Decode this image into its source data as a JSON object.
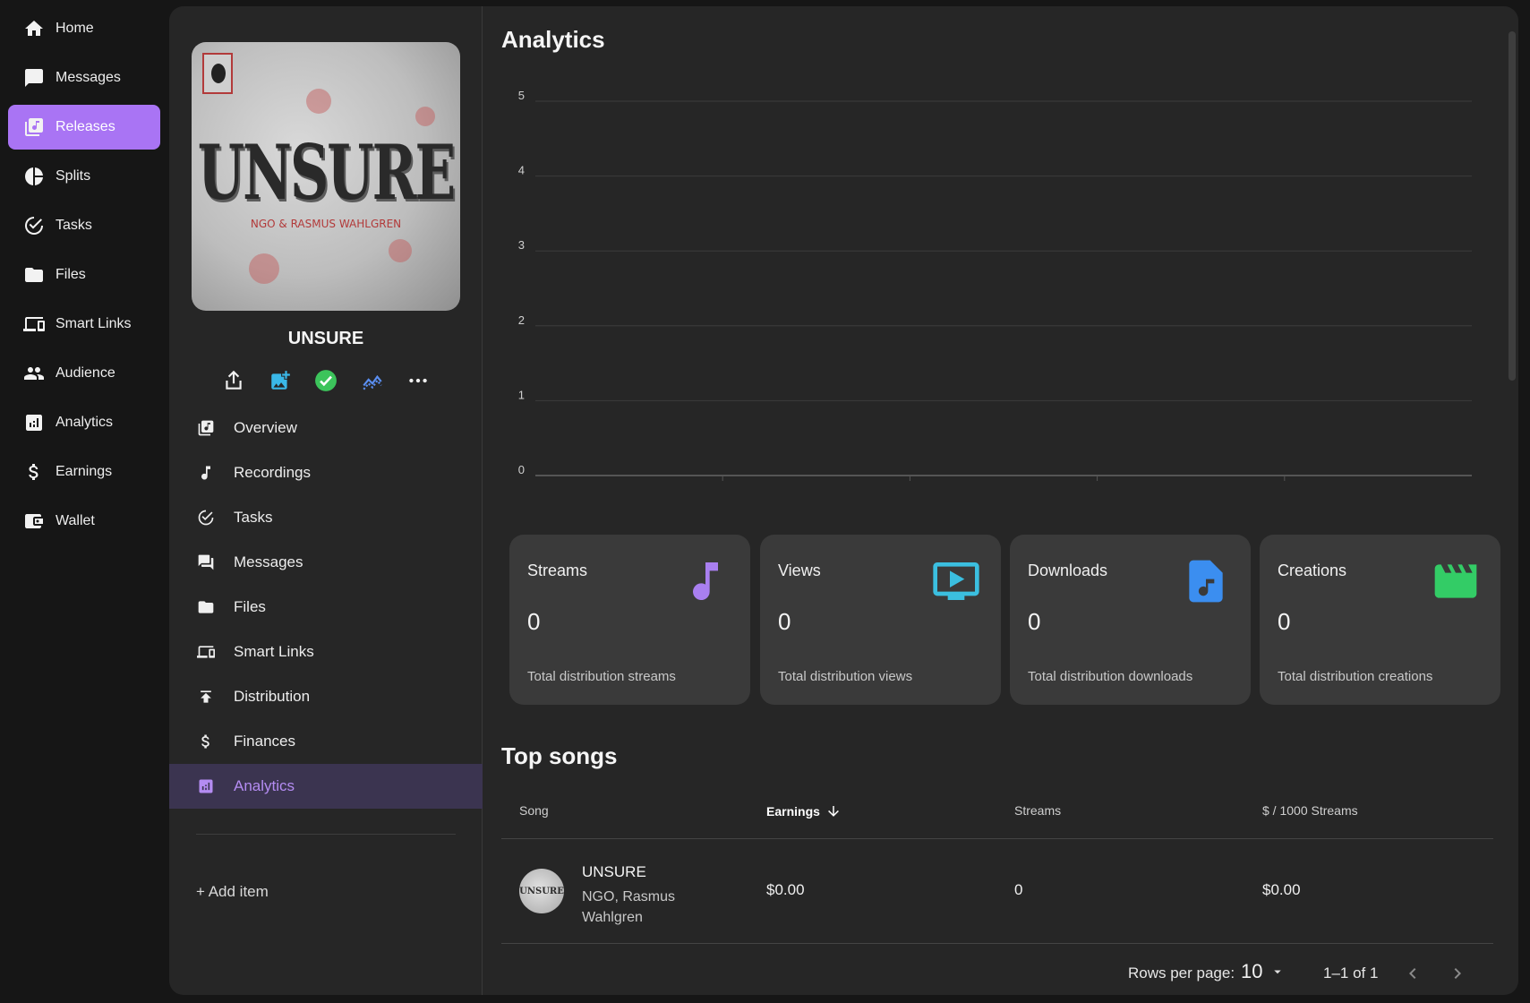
{
  "sidebar": {
    "items": [
      {
        "label": "Home",
        "icon": "home-icon"
      },
      {
        "label": "Messages",
        "icon": "chat-icon"
      },
      {
        "label": "Releases",
        "icon": "releases-icon",
        "active": true
      },
      {
        "label": "Splits",
        "icon": "pie-chart-icon"
      },
      {
        "label": "Tasks",
        "icon": "check-circle-icon"
      },
      {
        "label": "Files",
        "icon": "folder-icon"
      },
      {
        "label": "Smart Links",
        "icon": "devices-icon"
      },
      {
        "label": "Audience",
        "icon": "people-icon"
      },
      {
        "label": "Analytics",
        "icon": "bar-chart-icon"
      },
      {
        "label": "Earnings",
        "icon": "dollar-icon"
      },
      {
        "label": "Wallet",
        "icon": "wallet-icon"
      }
    ],
    "accent": "#a974f4"
  },
  "release": {
    "name": "UNSURE",
    "cover_title": "UNSURE",
    "cover_artists": "NGO & RASMUS WAHLGREN",
    "actions": [
      "share-icon",
      "add-image-icon",
      "check-icon",
      "insights-icon",
      "more-icon"
    ],
    "menu": [
      {
        "label": "Overview",
        "icon": "releases-icon"
      },
      {
        "label": "Recordings",
        "icon": "music-note-icon"
      },
      {
        "label": "Tasks",
        "icon": "check-circle-icon"
      },
      {
        "label": "Messages",
        "icon": "forum-icon"
      },
      {
        "label": "Files",
        "icon": "folder-icon"
      },
      {
        "label": "Smart Links",
        "icon": "devices-icon"
      },
      {
        "label": "Distribution",
        "icon": "publish-icon"
      },
      {
        "label": "Finances",
        "icon": "dollar-icon"
      },
      {
        "label": "Analytics",
        "icon": "bar-chart-icon",
        "active": true
      }
    ],
    "add_item": "+ Add item"
  },
  "analytics": {
    "title": "Analytics",
    "chart_data": {
      "type": "line",
      "title": "",
      "xlabel": "",
      "ylabel": "",
      "y_ticks": [
        "5",
        "4",
        "3",
        "2",
        "1",
        "0"
      ],
      "ylim": [
        0,
        5
      ],
      "grid": true,
      "series": []
    },
    "stats": [
      {
        "label": "Streams",
        "value": "0",
        "desc": "Total distribution streams",
        "icon": "music-note-icon",
        "color": "#a97ff0"
      },
      {
        "label": "Views",
        "value": "0",
        "desc": "Total distribution views",
        "icon": "play-screen-icon",
        "color": "#3bbfe0"
      },
      {
        "label": "Downloads",
        "value": "0",
        "desc": "Total distribution downloads",
        "icon": "audio-file-icon",
        "color": "#3b8ef0"
      },
      {
        "label": "Creations",
        "value": "0",
        "desc": "Total distribution creations",
        "icon": "clapperboard-icon",
        "color": "#33cc66"
      }
    ]
  },
  "top_songs": {
    "title": "Top songs",
    "columns": [
      "Song",
      "Earnings",
      "Streams",
      "$ / 1000 Streams"
    ],
    "rows": [
      {
        "thumb_text": "UNSURE",
        "title": "UNSURE",
        "artist": "NGO, Rasmus Wahlgren",
        "earnings": "$0.00",
        "streams": "0",
        "per_1000": "$0.00"
      }
    ],
    "rows_per_page_label": "Rows per page:",
    "rows_per_page": "10",
    "range": "1–1 of 1"
  }
}
